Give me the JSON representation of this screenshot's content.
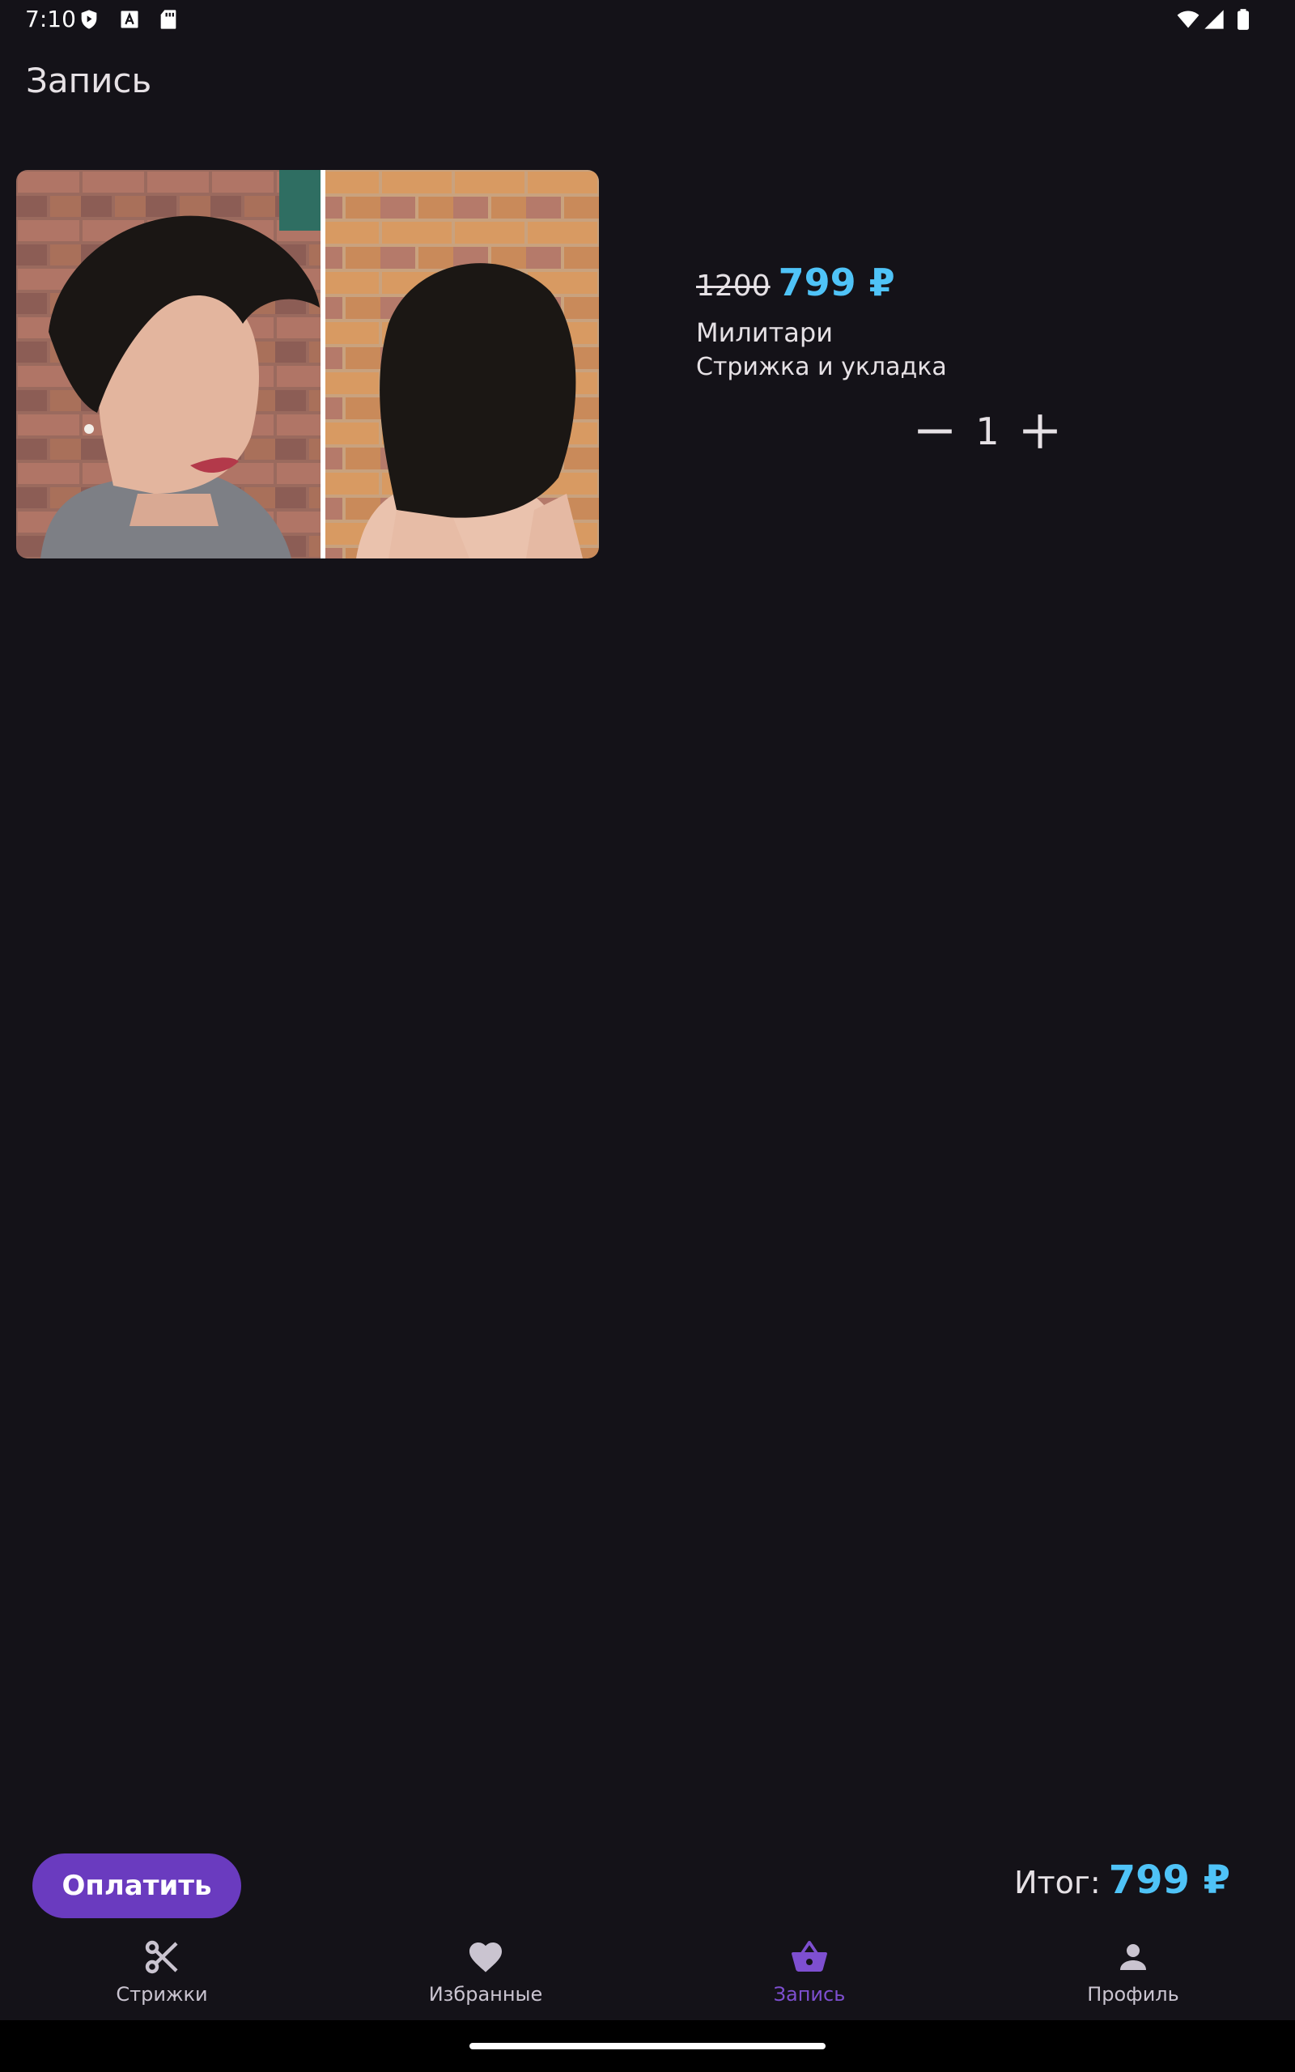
{
  "status_bar": {
    "time": "7:10",
    "left_icons": [
      "shield-play-icon",
      "font-a-icon",
      "sd-card-icon"
    ],
    "right_icons": [
      "wifi-icon",
      "cell-signal-icon",
      "battery-icon"
    ]
  },
  "app_bar": {
    "title": "Запись"
  },
  "cart_item": {
    "image": "haircut-photo",
    "old_price": "1200",
    "new_price": "799 ₽",
    "name": "Милитари",
    "description": "Стрижка и укладка",
    "quantity": "1",
    "decrement_icon": "minus-icon",
    "increment_icon": "plus-icon"
  },
  "checkout": {
    "pay_label": "Оплатить",
    "total_label": "Итог:",
    "total_value": "799 ₽"
  },
  "bottom_nav": {
    "items": [
      {
        "label": "Стрижки",
        "icon": "scissors-icon",
        "active": false
      },
      {
        "label": "Избранные",
        "icon": "heart-icon",
        "active": false
      },
      {
        "label": "Запись",
        "icon": "basket-icon",
        "active": true
      },
      {
        "label": "Профиль",
        "icon": "person-icon",
        "active": false
      }
    ]
  },
  "colors": {
    "background": "#141218",
    "price_accent": "#4fc3f7",
    "primary": "#6a3bbf",
    "nav_active": "#7e4fd0",
    "nav_inactive": "#cac4d0"
  }
}
